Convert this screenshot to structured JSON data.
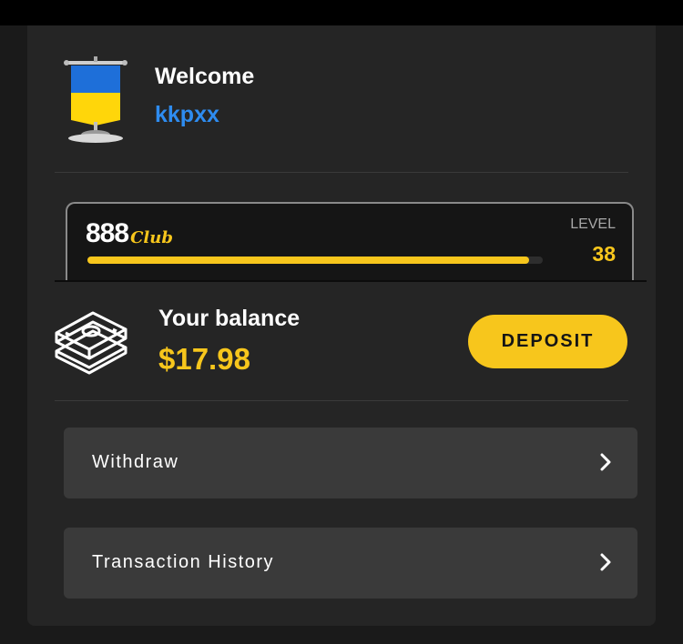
{
  "profile": {
    "welcome": "Welcome",
    "username": "kkpxx",
    "flag_icon": "ukraine-flag-banner-icon"
  },
  "club": {
    "logo_number": "888",
    "logo_word": "Club",
    "level_label": "LEVEL",
    "level_value": "38",
    "progress_fraction": 0.97
  },
  "balance": {
    "label": "Your balance",
    "amount": "$17.98",
    "icon": "cash-stack-icon"
  },
  "actions": {
    "deposit_label": "DEPOSIT"
  },
  "menu": [
    {
      "label": "Withdraw",
      "icon": "chevron-right-icon"
    },
    {
      "label": "Transaction History",
      "icon": "chevron-right-icon"
    }
  ],
  "colors": {
    "accent": "#f7c61c",
    "link": "#2e8cf0",
    "card": "#252525",
    "row": "#3a3a3a"
  }
}
